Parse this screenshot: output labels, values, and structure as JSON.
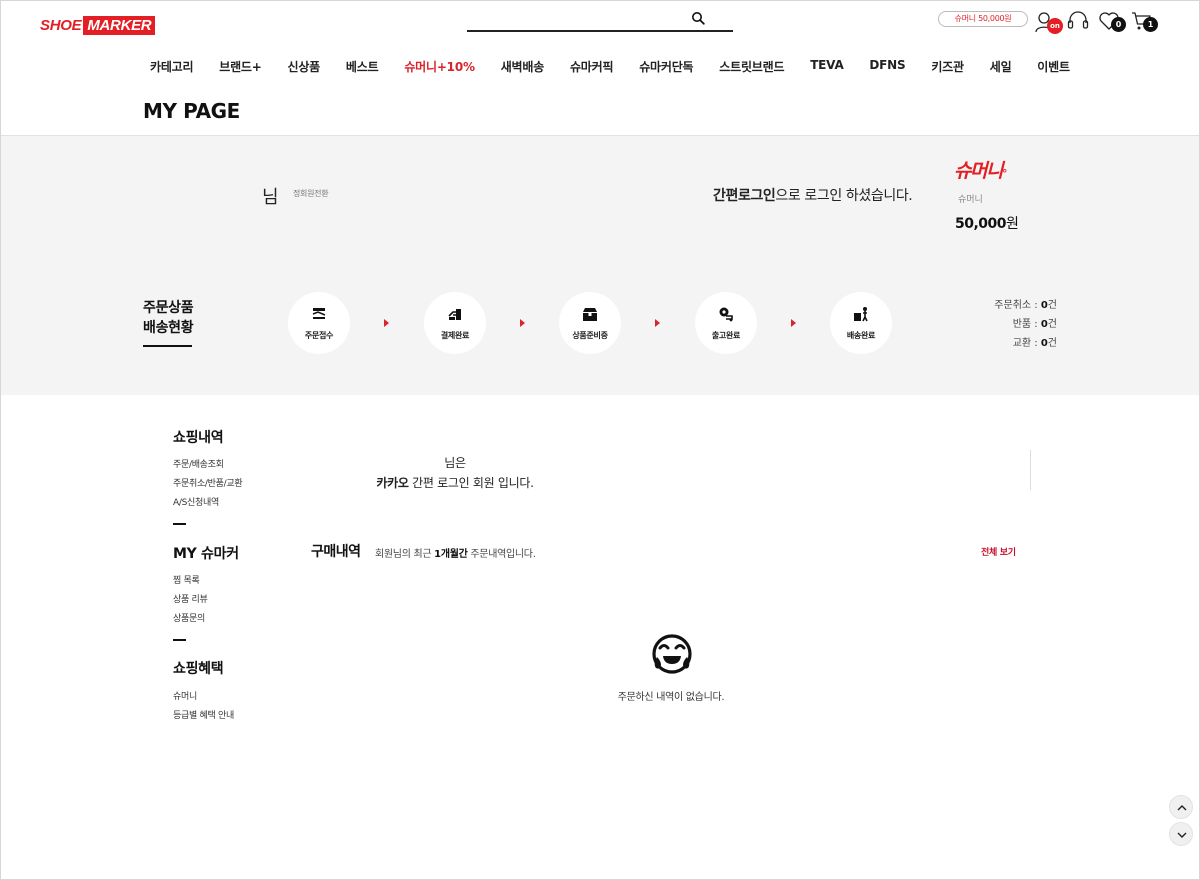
{
  "header": {
    "logo_left": "SHOE",
    "logo_right": "MARKER",
    "search_placeholder": "",
    "shoemoney_pill": "슈머니 50,000원",
    "mypage_badge": "on",
    "wish_count": "0",
    "cart_count": "1"
  },
  "gnb": [
    {
      "label": "카테고리"
    },
    {
      "label": "브랜드+"
    },
    {
      "label": "신상품"
    },
    {
      "label": "베스트"
    },
    {
      "label": "슈머니+10%"
    },
    {
      "label": "새벽배송"
    },
    {
      "label": "슈마커픽"
    },
    {
      "label": "슈마커단독"
    },
    {
      "label": "스트릿브랜드"
    },
    {
      "label": "TEVA"
    },
    {
      "label": "DFNS"
    },
    {
      "label": "키즈관"
    },
    {
      "label": "세일"
    },
    {
      "label": "이벤트"
    }
  ],
  "page_title": "MY PAGE",
  "member": {
    "name_suffix": "님",
    "convert_link": "정회원전환",
    "login_msg_bold": "간편로그인",
    "login_msg_rest": "으로 로그인 하셨습니다.",
    "shoemoney_logo": "슈머니",
    "shoemoney_label": "슈머니",
    "shoemoney_amount": "50,000",
    "shoemoney_unit": "원"
  },
  "shipping": {
    "title_line1": "주문상품",
    "title_line2": "배송현황",
    "steps": [
      {
        "label": "주문접수",
        "icon": "order-receipt-icon"
      },
      {
        "label": "결제완료",
        "icon": "payment-icon"
      },
      {
        "label": "상품준비중",
        "icon": "package-icon"
      },
      {
        "label": "출고완료",
        "icon": "shipped-icon"
      },
      {
        "label": "배송완료",
        "icon": "delivered-icon"
      }
    ],
    "counts": [
      {
        "label": "주문취소 : ",
        "value": "0",
        "unit": "건"
      },
      {
        "label": "반품 : ",
        "value": "0",
        "unit": "건"
      },
      {
        "label": "교환 : ",
        "value": "0",
        "unit": "건"
      }
    ]
  },
  "side": {
    "sections": [
      {
        "title": "쇼핑내역",
        "links": [
          "주문/배송조회",
          "주문취소/반품/교환",
          "A/S신청내역"
        ]
      },
      {
        "title": "MY 슈마커",
        "links": [
          "찜 목록",
          "상품 리뷰",
          "상품문의"
        ]
      },
      {
        "title": "쇼핑혜택",
        "links": [
          "슈머니",
          "등급별 혜택 안내"
        ]
      }
    ]
  },
  "kakao": {
    "line1": "님은",
    "bold": "카카오",
    "rest": " 간편 로그인 회원 입니다."
  },
  "purchase": {
    "title": "구매내역",
    "desc_pre": "회원님의 최근 ",
    "desc_bold": "1개월간",
    "desc_post": " 주문내역입니다.",
    "view_all": "전체 보기",
    "empty_msg": "주문하신 내역이 없습니다."
  }
}
